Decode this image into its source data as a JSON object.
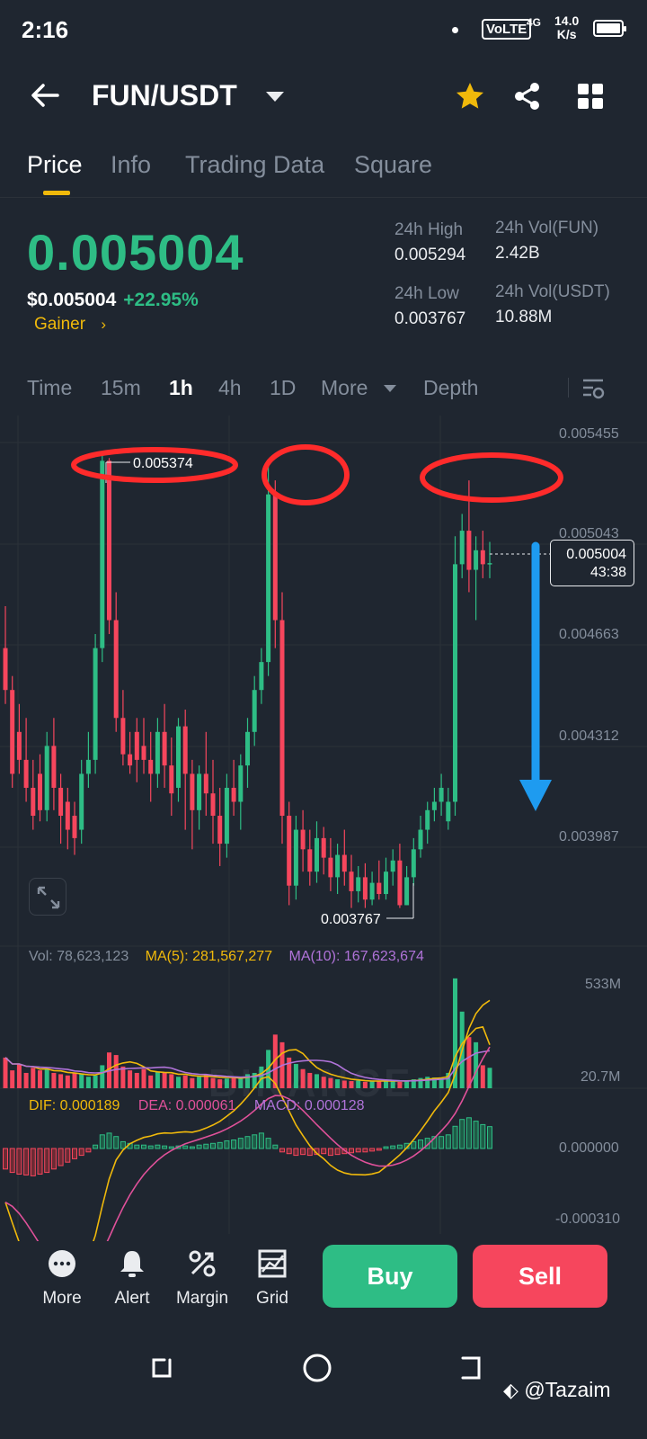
{
  "status": {
    "time": "2:16",
    "volte": "VoLTE",
    "signal": "4G",
    "net_speed": "14.0",
    "net_unit": "K/s"
  },
  "header": {
    "pair": "FUN/USDT",
    "icons": [
      "back-arrow-icon",
      "star-icon",
      "share-icon",
      "grid-icon"
    ],
    "star_color": "#f0b90b"
  },
  "tabs": [
    "Price",
    "Info",
    "Trading Data",
    "Square"
  ],
  "active_tab": "Price",
  "ticker": {
    "last_price": "0.005004",
    "usd_price": "$0.005004",
    "change": "+22.95%",
    "badge": "Gainer",
    "high_label": "24h High",
    "high": "0.005294",
    "low_label": "24h Low",
    "low": "0.003767",
    "vol_base_label": "24h Vol(FUN)",
    "vol_base": "2.42B",
    "vol_quote_label": "24h Vol(USDT)",
    "vol_quote": "10.88M"
  },
  "intervals": {
    "items": [
      "Time",
      "15m",
      "1h",
      "4h",
      "1D",
      "More",
      "Depth"
    ],
    "active": "1h"
  },
  "chart": {
    "watermark": "BINANCE",
    "price_axis": [
      "0.005455",
      "0.005043",
      "0.004663",
      "0.004312",
      "0.003987"
    ],
    "high_marker": "0.005374",
    "low_marker": "0.003767",
    "current_price": "0.005004",
    "countdown": "43:38",
    "volume_line": {
      "vol": "Vol: 78,623,123",
      "ma5": "MA(5): 281,567,277",
      "ma10": "MA(10): 167,623,674"
    },
    "volume_axis": [
      "533M",
      "20.7M"
    ],
    "macd_line": {
      "dif": "DIF: 0.000189",
      "dea": "DEA: 0.000061",
      "macd": "MACD: 0.000128"
    },
    "macd_axis": [
      "0.000000",
      "-0.000310"
    ],
    "colors": {
      "up": "#2ebd85",
      "down": "#f6465d",
      "ma5": "#f0b90b",
      "ma10": "#b073d9",
      "annotation": "#ff2b2b",
      "arrow": "#1e9bf0"
    }
  },
  "chart_data": {
    "type": "candlestick",
    "price_range": [
      0.00373,
      0.0055
    ],
    "candles": [
      [
        0.0047,
        0.00485,
        0.00455,
        0.0045
      ],
      [
        0.00455,
        0.0046,
        0.00425,
        0.0042
      ],
      [
        0.0044,
        0.0045,
        0.0043,
        0.00425
      ],
      [
        0.0043,
        0.00445,
        0.0042,
        0.00415
      ],
      [
        0.0042,
        0.0043,
        0.0041,
        0.00405
      ],
      [
        0.00425,
        0.00432,
        0.00412,
        0.00408
      ],
      [
        0.00412,
        0.0044,
        0.00435,
        0.00408
      ],
      [
        0.00435,
        0.00445,
        0.0042,
        0.00412
      ],
      [
        0.0042,
        0.00425,
        0.0041,
        0.004
      ],
      [
        0.00415,
        0.0042,
        0.00405,
        0.00398
      ],
      [
        0.0041,
        0.00415,
        0.00402,
        0.00396
      ],
      [
        0.00405,
        0.0043,
        0.00425,
        0.004
      ],
      [
        0.00425,
        0.0044,
        0.0043,
        0.0042
      ],
      [
        0.0043,
        0.00475,
        0.0047,
        0.00425
      ],
      [
        0.0047,
        0.0054,
        0.00537,
        0.00465
      ],
      [
        0.00537,
        0.00538,
        0.0048,
        0.00475
      ],
      [
        0.0048,
        0.0049,
        0.00445,
        0.0044
      ],
      [
        0.00445,
        0.00455,
        0.00432,
        0.00428
      ],
      [
        0.00432,
        0.0044,
        0.00428,
        0.00425
      ],
      [
        0.0044,
        0.00445,
        0.0043,
        0.00422
      ],
      [
        0.00435,
        0.00445,
        0.0043,
        0.00425
      ],
      [
        0.0043,
        0.0044,
        0.00425,
        0.00415
      ],
      [
        0.00425,
        0.00445,
        0.0044,
        0.0042
      ],
      [
        0.0044,
        0.0045,
        0.00428,
        0.0042
      ],
      [
        0.00428,
        0.00438,
        0.00418,
        0.0041
      ],
      [
        0.0042,
        0.00445,
        0.00442,
        0.00415
      ],
      [
        0.00442,
        0.00448,
        0.00425,
        0.00405
      ],
      [
        0.00425,
        0.0043,
        0.00412,
        0.00398
      ],
      [
        0.00412,
        0.00428,
        0.00425,
        0.00405
      ],
      [
        0.00425,
        0.0044,
        0.00418,
        0.0041
      ],
      [
        0.00418,
        0.0043,
        0.0041,
        0.004
      ],
      [
        0.0041,
        0.0042,
        0.004,
        0.00392
      ],
      [
        0.004,
        0.00425,
        0.0042,
        0.00395
      ],
      [
        0.0042,
        0.0043,
        0.00415,
        0.0041
      ],
      [
        0.00415,
        0.00432,
        0.00428,
        0.00405
      ],
      [
        0.00428,
        0.00445,
        0.0044,
        0.0042
      ],
      [
        0.0044,
        0.0046,
        0.00455,
        0.00435
      ],
      [
        0.00455,
        0.0047,
        0.00465,
        0.0045
      ],
      [
        0.00465,
        0.00535,
        0.00525,
        0.0046
      ],
      [
        0.00525,
        0.0053,
        0.0048,
        0.0047
      ],
      [
        0.0048,
        0.0049,
        0.0041,
        0.004
      ],
      [
        0.0041,
        0.00415,
        0.00385,
        0.00378
      ],
      [
        0.00385,
        0.0041,
        0.00405,
        0.0038
      ],
      [
        0.00405,
        0.00412,
        0.00398,
        0.0039
      ],
      [
        0.00398,
        0.00405,
        0.0039,
        0.00385
      ],
      [
        0.0039,
        0.00408,
        0.00402,
        0.00386
      ],
      [
        0.00402,
        0.00406,
        0.00395,
        0.00389
      ],
      [
        0.00395,
        0.00402,
        0.00388,
        0.00383
      ],
      [
        0.00388,
        0.004,
        0.00396,
        0.00382
      ],
      [
        0.00396,
        0.00405,
        0.0039,
        0.00385
      ],
      [
        0.0039,
        0.00396,
        0.00383,
        0.00377
      ],
      [
        0.00383,
        0.00392,
        0.00388,
        0.00379
      ],
      [
        0.00388,
        0.00393,
        0.0038,
        0.00377
      ],
      [
        0.0038,
        0.0039,
        0.00386,
        0.00378
      ],
      [
        0.00386,
        0.00394,
        0.00382,
        0.0038
      ],
      [
        0.00382,
        0.00395,
        0.0039,
        0.0038
      ],
      [
        0.0039,
        0.00398,
        0.00394,
        0.00385
      ],
      [
        0.00394,
        0.004,
        0.00378,
        0.00377
      ],
      [
        0.00378,
        0.00392,
        0.00388,
        0.00378
      ],
      [
        0.00388,
        0.00402,
        0.00398,
        0.00385
      ],
      [
        0.00398,
        0.0041,
        0.00405,
        0.00395
      ],
      [
        0.00405,
        0.00415,
        0.00412,
        0.004
      ],
      [
        0.00412,
        0.0042,
        0.00415,
        0.00408
      ],
      [
        0.00415,
        0.00425,
        0.0042,
        0.0041
      ],
      [
        0.00408,
        0.0042,
        0.00415,
        0.00405
      ],
      [
        0.00415,
        0.0051,
        0.005,
        0.0041
      ],
      [
        0.005,
        0.00518,
        0.00512,
        0.00495
      ],
      [
        0.00512,
        0.0053,
        0.00498,
        0.0049
      ],
      [
        0.00498,
        0.0051,
        0.00505,
        0.0048
      ],
      [
        0.00505,
        0.00512,
        0.005,
        0.00495
      ],
      [
        0.005,
        0.00508,
        0.005004,
        0.00495
      ]
    ],
    "volume": [
      120,
      70,
      95,
      60,
      80,
      70,
      75,
      60,
      55,
      50,
      60,
      55,
      45,
      50,
      90,
      140,
      130,
      85,
      70,
      60,
      75,
      50,
      65,
      60,
      55,
      45,
      50,
      40,
      45,
      55,
      40,
      35,
      38,
      45,
      40,
      55,
      60,
      85,
      150,
      210,
      180,
      120,
      95,
      75,
      60,
      55,
      45,
      40,
      35,
      30,
      28,
      30,
      25,
      28,
      30,
      32,
      28,
      25,
      30,
      35,
      40,
      45,
      42,
      40,
      60,
      430,
      300,
      200,
      180,
      90,
      80
    ],
    "macd_hist": [
      -0.00012,
      -0.00014,
      -0.00015,
      -0.000155,
      -0.00016,
      -0.00015,
      -0.00014,
      -0.00012,
      -0.0001,
      -8e-05,
      -6e-05,
      -4e-05,
      -2e-05,
      2e-05,
      8e-05,
      9e-05,
      7e-05,
      4e-05,
      3e-05,
      2e-05,
      2e-05,
      1.5e-05,
      2e-05,
      1.5e-05,
      1e-05,
      1.5e-05,
      1.5e-05,
      1e-05,
      2e-05,
      2.5e-05,
      3e-05,
      3.5e-05,
      4.5e-05,
      5e-05,
      6e-05,
      7e-05,
      8e-05,
      9e-05,
      6e-05,
      2e-05,
      -2e-05,
      -3e-05,
      -4e-05,
      -3.5e-05,
      -4e-05,
      -3.5e-05,
      -3e-05,
      -4e-05,
      -3.5e-05,
      -3e-05,
      -2.5e-05,
      -2e-05,
      -2e-05,
      -1.5e-05,
      -1e-05,
      1e-05,
      1.5e-05,
      2e-05,
      3e-05,
      4e-05,
      5e-05,
      6e-05,
      7e-05,
      7e-05,
      8e-05,
      0.00013,
      0.00017,
      0.00018,
      0.00016,
      0.00014,
      0.000128
    ]
  },
  "toolbar": {
    "more": "More",
    "alert": "Alert",
    "margin": "Margin",
    "grid": "Grid",
    "buy": "Buy",
    "sell": "Sell"
  },
  "credit": "@Tazaim"
}
